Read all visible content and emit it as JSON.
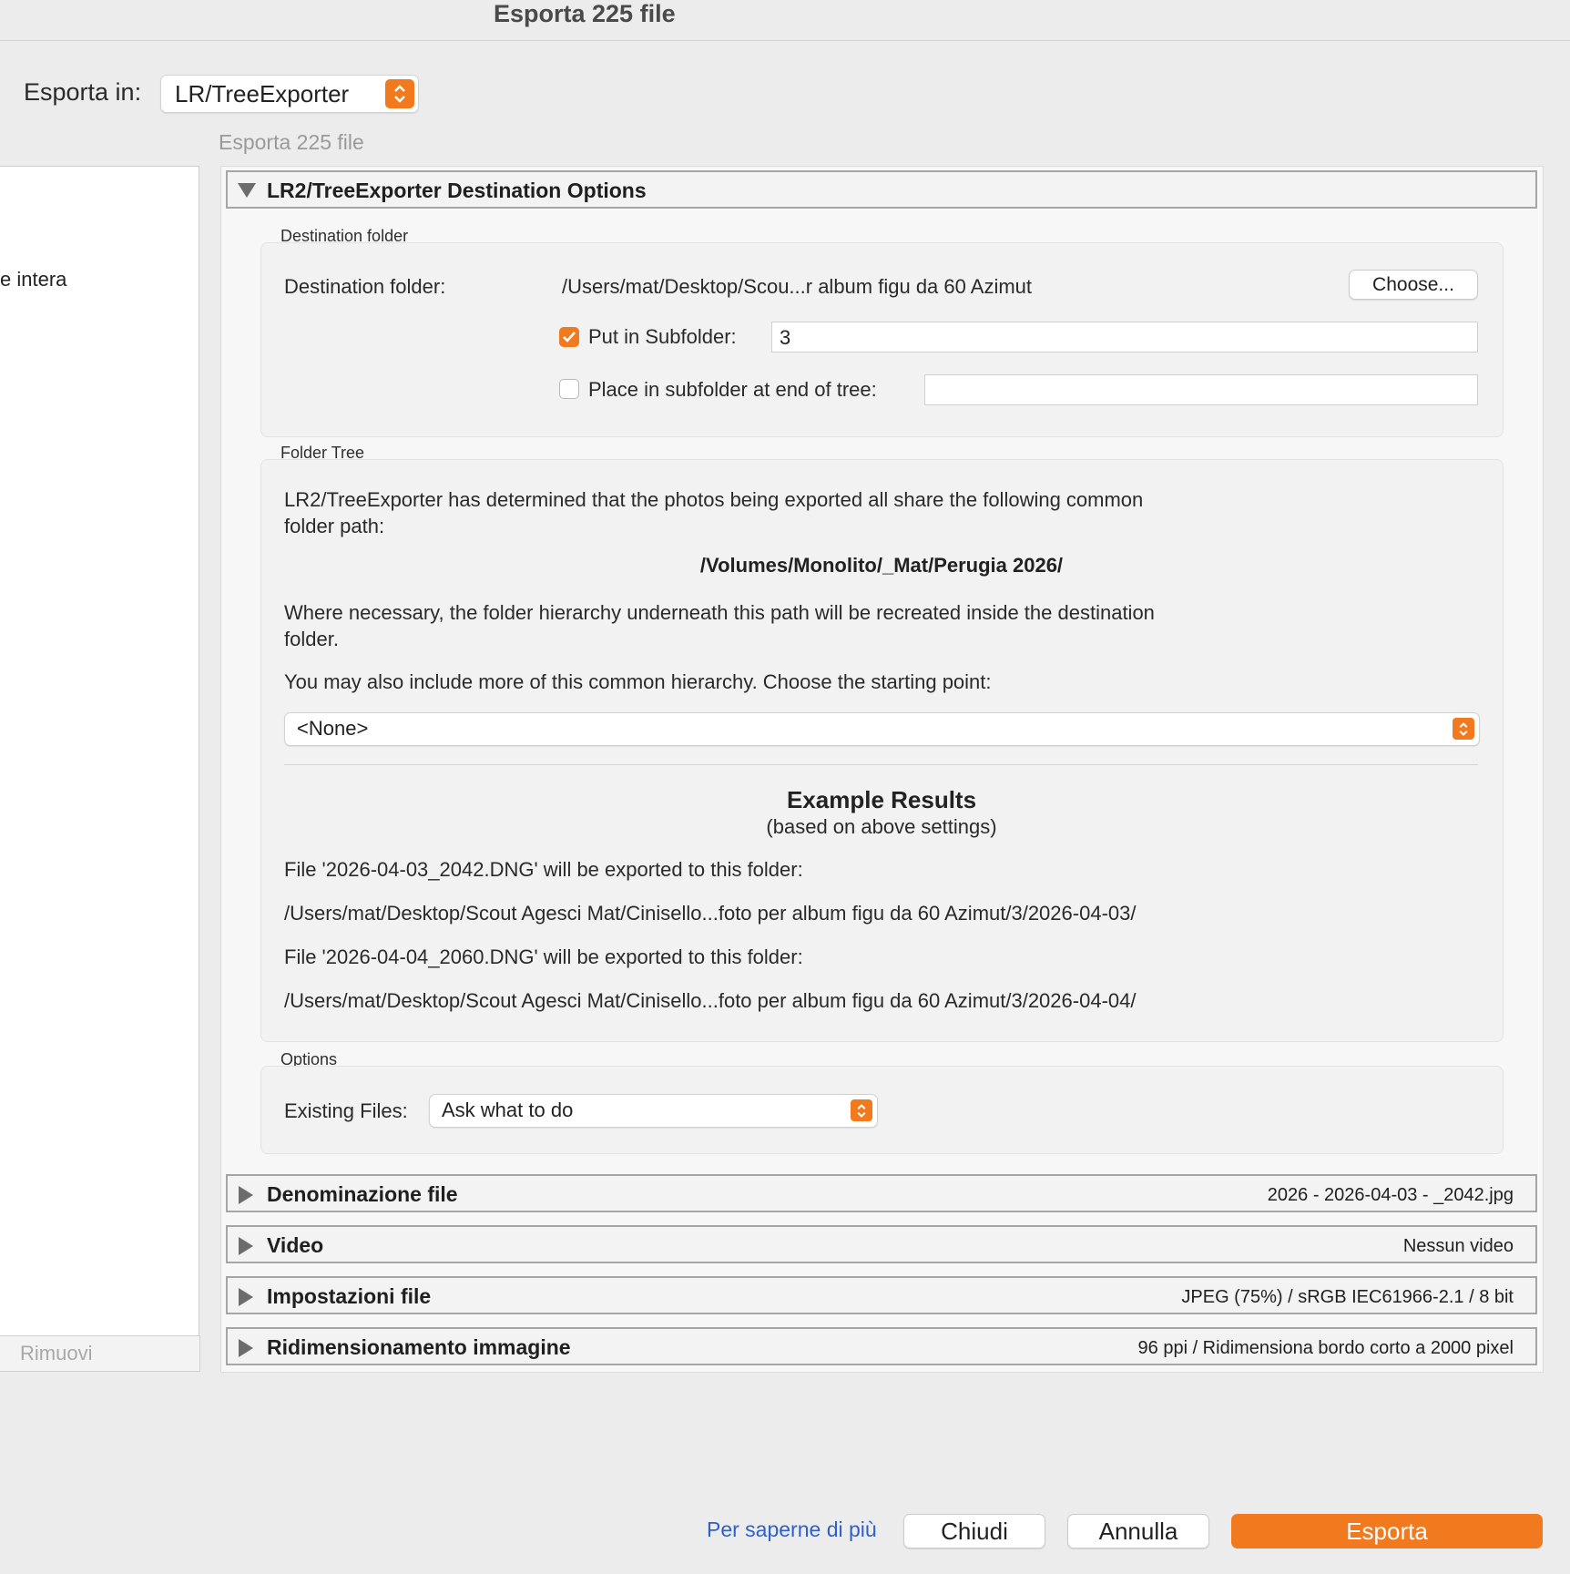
{
  "window": {
    "title": "Esporta 225 file"
  },
  "export_to": {
    "label": "Esporta in:",
    "value": "LR/TreeExporter"
  },
  "subtitle": "Esporta 225 file",
  "sidebar": {
    "partial_item": "e intera",
    "remove_label": "Rimuovi"
  },
  "destination_options": {
    "title": "LR2/TreeExporter Destination Options",
    "dest_group_label": "Destination folder",
    "dest_label": "Destination folder:",
    "dest_path": "/Users/mat/Desktop/Scou...r album figu da 60 Azimut",
    "choose_label": "Choose...",
    "put_in_subfolder_label": "Put in Subfolder:",
    "put_in_subfolder_checked": true,
    "subfolder_value": "3",
    "place_end_tree_label": "Place in subfolder at end of tree:",
    "place_end_tree_checked": false,
    "place_end_tree_value": "",
    "tree_group_label": "Folder Tree",
    "tree_intro": "LR2/TreeExporter has determined that the photos being exported all share the following common folder path:",
    "common_path": "/Volumes/Monolito/_Mat/Perugia 2026/",
    "hierarchy_note": "Where necessary, the folder hierarchy underneath this path will be recreated inside the destination folder.",
    "starting_point_prompt": "You may also include more of this common hierarchy.  Choose the starting point:",
    "starting_point_value": "<None>",
    "example_title": "Example Results",
    "example_subtitle": "(based on above settings)",
    "example_1_text": "File '2026-04-03_2042.DNG' will be exported to this folder:",
    "example_1_path": "/Users/mat/Desktop/Scout Agesci Mat/Cinisello...foto per album figu da 60 Azimut/3/2026-04-03/",
    "example_2_text": "File '2026-04-04_2060.DNG' will be exported to this folder:",
    "example_2_path": "/Users/mat/Desktop/Scout Agesci Mat/Cinisello...foto per album figu da 60 Azimut/3/2026-04-04/",
    "options_group_label": "Options",
    "existing_files_label": "Existing Files:",
    "existing_files_value": "Ask what to do"
  },
  "sections": [
    {
      "title": "Denominazione file",
      "summary": "2026 - 2026-04-03 - _2042.jpg"
    },
    {
      "title": "Video",
      "summary": "Nessun video"
    },
    {
      "title": "Impostazioni file",
      "summary": "JPEG (75%) / sRGB IEC61966-2.1 / 8 bit"
    },
    {
      "title": "Ridimensionamento immagine",
      "summary": "96 ppi / Ridimensiona bordo corto a 2000 pixel"
    }
  ],
  "footer": {
    "learn_more": "Per saperne di più",
    "close": "Chiudi",
    "cancel": "Annulla",
    "export": "Esporta"
  },
  "colors": {
    "accent": "#f27a1e",
    "link": "#2f5fc8"
  },
  "icons": [
    "stepper-icon",
    "disclosure-open-icon",
    "disclosure-closed-icon",
    "checkmark-icon"
  ]
}
